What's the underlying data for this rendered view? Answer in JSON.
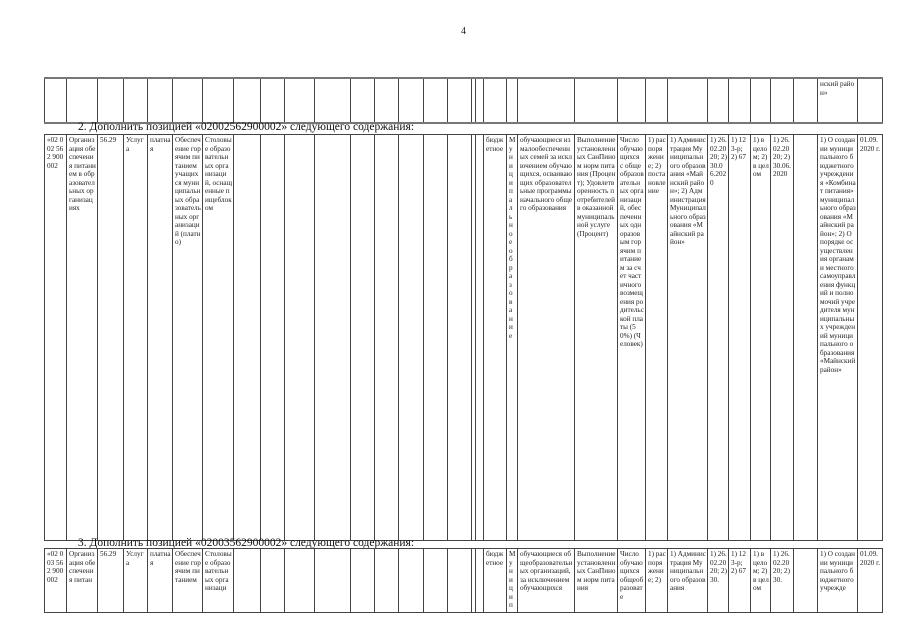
{
  "page_number": "4",
  "top_table": {
    "cells": [
      "",
      "",
      "",
      "",
      "",
      "",
      "",
      "",
      "",
      "",
      "",
      "",
      "",
      "",
      "",
      "",
      "",
      "",
      "",
      "",
      "",
      "",
      "",
      "",
      "",
      "",
      "",
      "",
      "",
      "",
      "нский район»",
      ""
    ]
  },
  "section2": {
    "heading": "2. Дополнить позицией «02002562900002» следующего содержания:",
    "cells": [
      "«02 002 562 900 002",
      "Организация обеспечения питанием в образовательных организациях",
      "56.29",
      "Услуга",
      "платная",
      "Обеспечение горячим питанием учащихся муниципальных образовательных организаций (платно)",
      "Столовые образовательных организаций, оснащенные пищеблоком",
      "",
      "",
      "",
      "",
      "",
      "",
      "",
      "",
      "",
      "",
      "",
      "бюджетное",
      "Муниципальное образование",
      "обучающиеся из малообеспеченных семей за исключением обучающихся, осваивающих образовательные программы начального общего образования",
      "Выполнение установленных СанПином норм питания (Процент); Удовлетворенность потребителей в оказанной муниципальной услуге (Процент)",
      "Число обучающихся с общеобразовательных организаций, обеспеченных одноразовым горячим питанием за счет частичного возмещения родительской платы (50%) (Человек)",
      "1) распоряжение; 2) постановление",
      "1) Администрация Муниципального образования «Майнский район»; 2) Администрация Муниципального образования «Майнский район»",
      "1) 26.02.2020; 2) 30.06.2020",
      "1) 123-р; 2) 67",
      "1) в целом; 2) в целом",
      "1) 26.02.2020; 2) 30.06.2020",
      "",
      "1) О создании муниципального бюджетного учреждения «Комбинат питания» муниципального образования «Майнский район»; 2) О порядке осуществления органами местного самоуправления функций и полномочий учредителя муниципальных учреждений муниципального образования «Майнский район»",
      "01.09.2020 г."
    ]
  },
  "section3": {
    "heading": "3. Дополнить позицией «02003562900002» следующего содержания:",
    "cells": [
      "«02 003 562 900 002",
      "Организация обеспечения питан",
      "56.29",
      "Услуга",
      "платная",
      "Обеспечение горячим питанием",
      "Столовые образовательных организаци",
      "",
      "",
      "",
      "",
      "",
      "",
      "",
      "",
      "",
      "",
      "",
      "бюджетное",
      "Муницип",
      "обучающиеся общеобразовательных организаций, за исключением обучающихся",
      "Выполнение установленных СанПином норм питания",
      "Число обучающихся общеобразовате",
      "1) распоряжение; 2)",
      "1) Администрация Муниципального образования",
      "1) 26.02.2020; 2) 30.",
      "1) 123-р; 2) 67",
      "1) в целом; 2) в целом",
      "1) 26.02.2020; 2) 30.",
      "",
      "1) О создании муниципального бюджетного учрежде",
      "01.09.2020 г."
    ]
  }
}
